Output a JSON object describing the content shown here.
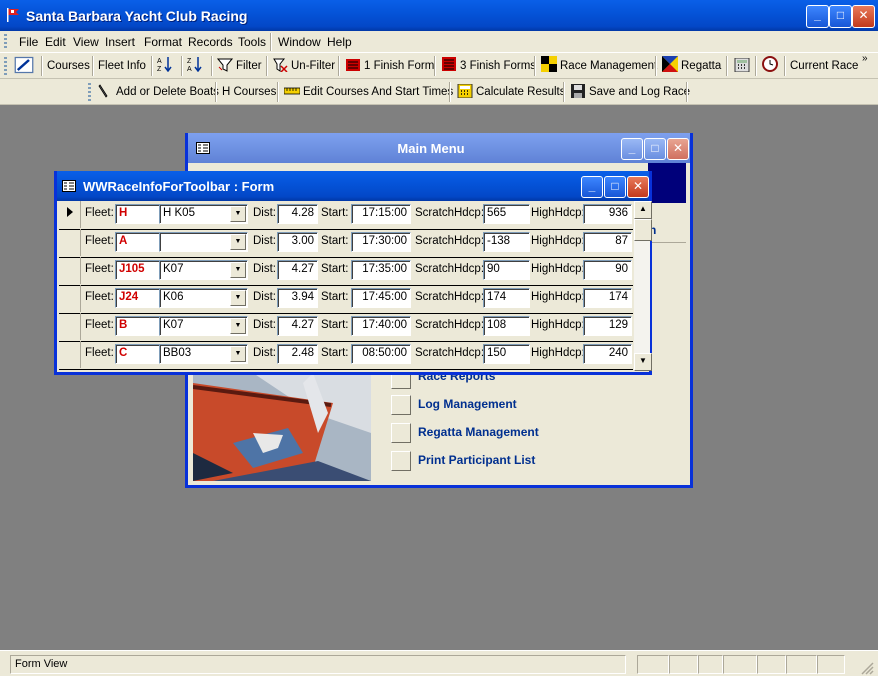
{
  "app": {
    "title": "Santa Barbara Yacht Club Racing",
    "controls": {
      "minimize": "_",
      "maximize": "□",
      "close": "✕"
    }
  },
  "menubar": {
    "items": [
      "File",
      "Edit",
      "View",
      "Insert",
      "Format",
      "Records",
      "Tools",
      "Window",
      "Help"
    ]
  },
  "toolbar1": {
    "courses": "Courses",
    "fleet_info": "Fleet Info",
    "filter": "Filter",
    "unfilter": "Un-Filter",
    "finish_form_1": "1 Finish Form",
    "finish_forms_3": "3 Finish Forms",
    "race_management": "Race Management",
    "regatta": "Regatta",
    "current_race": "Current Race",
    "overflow": "»"
  },
  "toolbar2": {
    "add_delete_boats": "Add or Delete Boats",
    "h_courses": "H Courses",
    "edit_courses": "Edit Courses And Start Times",
    "calculate_results": "Calculate Results",
    "save_log_race": "Save and Log Race"
  },
  "main_menu": {
    "title": "Main Menu",
    "partial_text": "n",
    "items": [
      "Race Reports",
      "Log Management",
      "Regatta Management",
      "Print Participant List"
    ]
  },
  "form": {
    "title": "WWRaceInfoForToolbar : Form",
    "labels": {
      "fleet": "Fleet:",
      "dist": "Dist:",
      "start": "Start:",
      "scratch": "ScratchHdcp:",
      "high": "HighHdcp:"
    },
    "rows": [
      {
        "fleet": "H",
        "course": "H K05",
        "dist": "4.28",
        "start": "17:15:00",
        "scratch": "565",
        "high": "936"
      },
      {
        "fleet": "A",
        "course": "",
        "dist": "3.00",
        "start": "17:30:00",
        "scratch": "-138",
        "high": "87"
      },
      {
        "fleet": "J105",
        "course": "K07",
        "dist": "4.27",
        "start": "17:35:00",
        "scratch": "90",
        "high": "90"
      },
      {
        "fleet": "J24",
        "course": "K06",
        "dist": "3.94",
        "start": "17:45:00",
        "scratch": "174",
        "high": "174"
      },
      {
        "fleet": "B",
        "course": "K07",
        "dist": "4.27",
        "start": "17:40:00",
        "scratch": "108",
        "high": "129"
      },
      {
        "fleet": "C",
        "course": "BB03",
        "dist": "2.48",
        "start": "08:50:00",
        "scratch": "150",
        "high": "240"
      }
    ]
  },
  "status": {
    "text": "Form View"
  },
  "colors": {
    "fleet_text": "#d00000",
    "titlebar": "#0554d9",
    "desktop": "#808080"
  }
}
